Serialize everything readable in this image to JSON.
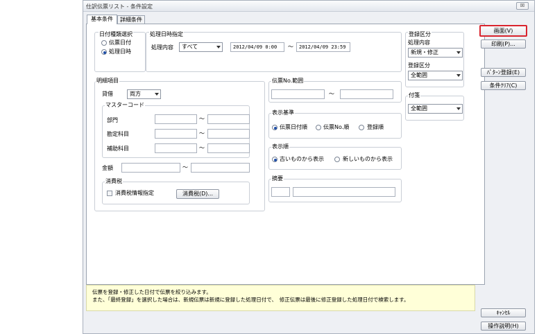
{
  "window": {
    "title": "仕訳伝票リスト - 条件設定",
    "close_label": "☒"
  },
  "tabs": [
    {
      "label": "基本条件"
    },
    {
      "label": "詳細条件"
    }
  ],
  "date_type": {
    "title": "日付種類選択",
    "options": [
      "伝票日付",
      "処理日時"
    ],
    "selected": 1
  },
  "processing_datetime": {
    "title": "処理日時指定",
    "content_label": "処理内容",
    "content_value": "すべて",
    "from": "2012/04/09  0:00",
    "to": "2012/04/09 23:59",
    "tilde": "～"
  },
  "registration": {
    "title": "登録区分",
    "content_label": "処理内容",
    "content_value": "新規・修正",
    "category_label": "登録区分",
    "category_value": "全範囲"
  },
  "details": {
    "title": "明細項目",
    "side_label": "貸借",
    "side_value": "両方",
    "master_title": "マスターコード",
    "rows": [
      {
        "label": "部門",
        "from": "",
        "to": ""
      },
      {
        "label": "勘定科目",
        "from": "",
        "to": ""
      },
      {
        "label": "補助科目",
        "from": "",
        "to": ""
      }
    ],
    "amount_label": "金額",
    "tilde": "～"
  },
  "tax": {
    "title": "消費税",
    "checkbox_label": "消費税情報指定",
    "button_label": "消費税(D)..."
  },
  "voucher_range": {
    "title": "伝票No.範囲",
    "from": "",
    "to": "",
    "tilde": "～"
  },
  "sort_basis": {
    "title": "表示基準",
    "options": [
      "伝票日付順",
      "伝票No.順",
      "登録順"
    ],
    "selected": 0
  },
  "display_order": {
    "title": "表示順",
    "options": [
      "古いものから表示",
      "新しいものから表示"
    ],
    "selected": 0
  },
  "summary": {
    "title": "摘要",
    "code": "",
    "text": ""
  },
  "sticky": {
    "title": "付箋",
    "value": "全範囲"
  },
  "buttons": {
    "screen": "画面(V)",
    "print": "印刷(P)...",
    "pattern": "ﾊﾟﾀｰﾝ登録(E)",
    "clear": "条件ｸﾘｱ(C)",
    "cancel": "ｷｬﾝｾﾙ",
    "help": "操作説明(H)"
  },
  "message": {
    "line1": "伝票を登録・修正した日付で伝票を絞り込みます。",
    "line2": "また、「最終登録」を選択した場合は、新規伝票は新規に登録した処理日付で、　修正伝票は最後に修正登録した処理日付で検索します。"
  },
  "colors": {
    "focus_border": "#d9232d",
    "radio_dot": "#1f4fa8",
    "hint_bg": "#ffffd8"
  }
}
